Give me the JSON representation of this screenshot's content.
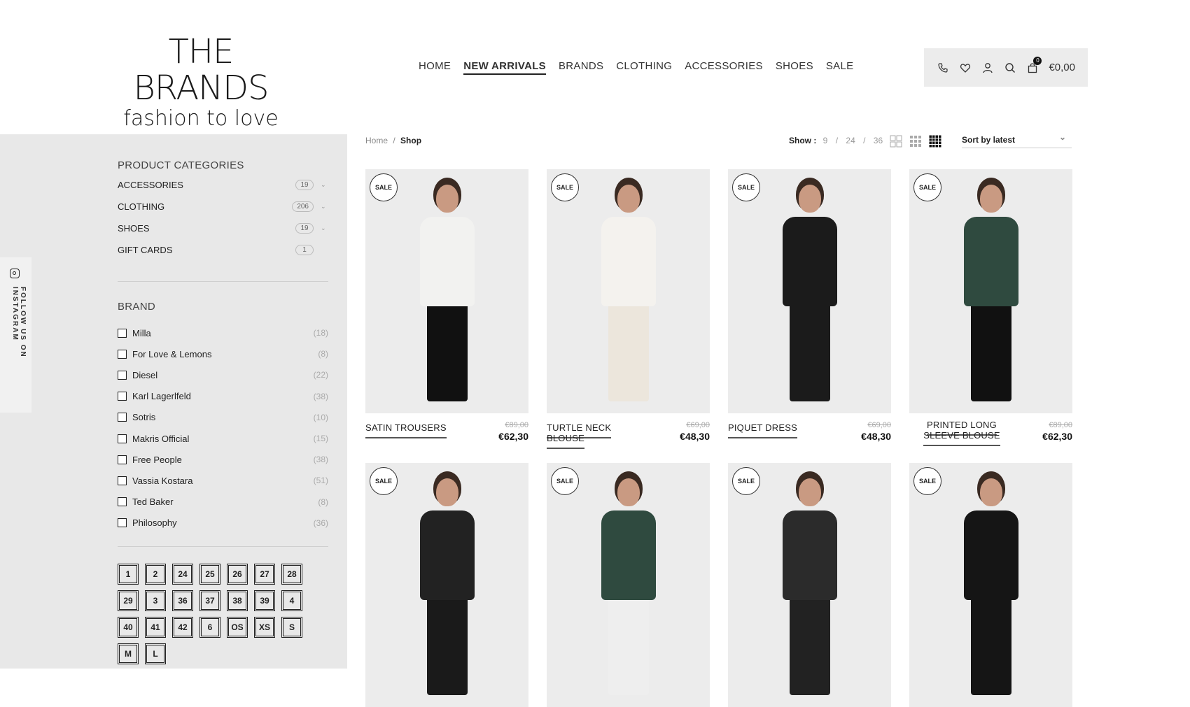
{
  "logo": {
    "title": "THE BRANDS",
    "subtitle": "fashion to love"
  },
  "nav": [
    "HOME",
    "NEW ARRIVALS",
    "BRANDS",
    "CLOTHING",
    "ACCESSORIES",
    "SHOES",
    "SALE"
  ],
  "nav_active": "NEW ARRIVALS",
  "cart": {
    "count": "0",
    "total": "€0,00"
  },
  "instagram": {
    "label": "FOLLOW US ON INSTAGRAM"
  },
  "sidebar": {
    "categories_title": "PRODUCT CATEGORIES",
    "categories": [
      {
        "label": "ACCESSORIES",
        "count": "19",
        "expandable": true
      },
      {
        "label": "CLOTHING",
        "count": "206",
        "expandable": true
      },
      {
        "label": "SHOES",
        "count": "19",
        "expandable": true
      },
      {
        "label": "GIFT CARDS",
        "count": "1",
        "expandable": false
      }
    ],
    "brand_title": "BRAND",
    "brands": [
      {
        "label": "Milla",
        "count": "(18)"
      },
      {
        "label": "For Love & Lemons",
        "count": "(8)"
      },
      {
        "label": "Diesel",
        "count": "(22)"
      },
      {
        "label": "Karl Lagerlfeld",
        "count": "(38)"
      },
      {
        "label": "Sotris",
        "count": "(10)"
      },
      {
        "label": "Makris Official",
        "count": "(15)"
      },
      {
        "label": "Free People",
        "count": "(38)"
      },
      {
        "label": "Vassia Kostara",
        "count": "(51)"
      },
      {
        "label": "Ted Baker",
        "count": "(8)"
      },
      {
        "label": "Philosophy",
        "count": "(36)"
      }
    ],
    "sizes": [
      "1",
      "2",
      "24",
      "25",
      "26",
      "27",
      "28",
      "29",
      "3",
      "36",
      "37",
      "38",
      "39",
      "4",
      "40",
      "41",
      "42",
      "6",
      "OS",
      "XS",
      "S",
      "M",
      "L"
    ]
  },
  "breadcrumb": {
    "home": "Home",
    "separator": "/",
    "current": "Shop"
  },
  "show": {
    "label": "Show :",
    "options": [
      "9",
      "24",
      "36"
    ],
    "separator": "/"
  },
  "sort": {
    "label": "Sort by latest"
  },
  "sale_badge": "SALE",
  "products": [
    {
      "name": "SATIN TROUSERS",
      "old_price": "€89,00",
      "price": "€62,30",
      "top": "#f2f2f0",
      "bottom": "#111",
      "bg": "#ececec"
    },
    {
      "name": "TURTLE NECK BLOUSE",
      "old_price": "€69,00",
      "price": "€48,30",
      "top": "#f4f2ee",
      "bottom": "#ece6dc",
      "bg": "#ececec"
    },
    {
      "name": "PIQUET DRESS",
      "old_price": "€69,00",
      "price": "€48,30",
      "top": "#1b1b1b",
      "bottom": "#1b1b1b",
      "bg": "#ececec"
    },
    {
      "name": "PRINTED LONG SLEEVE BLOUSE",
      "old_price": "€89,00",
      "price": "€62,30",
      "top": "#2f4a3f",
      "bottom": "#111",
      "bg": "#ececec"
    },
    {
      "name": "",
      "old_price": "",
      "price": "",
      "top": "#222",
      "bottom": "#1a1a1a",
      "bg": "#ececec"
    },
    {
      "name": "",
      "old_price": "",
      "price": "",
      "top": "#2f4a3f",
      "bottom": "#eee",
      "bg": "#ececec"
    },
    {
      "name": "",
      "old_price": "",
      "price": "",
      "top": "#2b2b2b",
      "bottom": "#222",
      "bg": "#ececec"
    },
    {
      "name": "",
      "old_price": "",
      "price": "",
      "top": "#151515",
      "bottom": "#151515",
      "bg": "#ececec"
    }
  ]
}
